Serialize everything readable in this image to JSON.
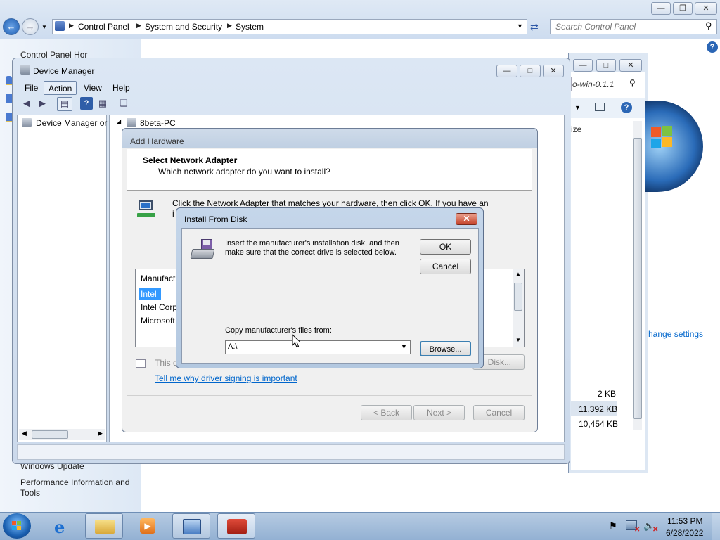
{
  "control_panel": {
    "breadcrumbs": [
      "Control Panel",
      "System and Security",
      "System"
    ],
    "search_placeholder": "Search Control Panel",
    "left_links": {
      "home": "Control Panel Hor",
      "windows_update": "Windows Update",
      "performance": "Performance Information and",
      "performance_2": "Tools"
    }
  },
  "system_window": {
    "search_value": "o-win-0.1.1",
    "col_header": "ize",
    "change_settings": "hange settings",
    "sizes": [
      "2 KB",
      "11,392 KB",
      "10,454 KB"
    ]
  },
  "device_manager": {
    "title": "Device Manager",
    "menu": [
      "File",
      "Action",
      "View",
      "Help"
    ],
    "tree_root": "Device Manager or",
    "computer_name": "8beta-PC"
  },
  "add_hardware": {
    "title": "Add Hardware",
    "heading": "Select Network Adapter",
    "subheading": "Which network adapter do you want to install?",
    "instruction": "Click the Network Adapter that matches your hardware, then click OK. If you have an",
    "instruction_cut": "i",
    "list_header": "Manufact",
    "manufacturers": [
      "Intel",
      "Intel Corp",
      "Microsoft"
    ],
    "signing_text": "This d",
    "signing_link": "Tell me why driver signing is important",
    "have_disk": "Disk...",
    "back": "< Back",
    "next": "Next >",
    "cancel": "Cancel"
  },
  "install_from_disk": {
    "title": "Install From Disk",
    "message_1": "Insert the manufacturer's installation disk, and then",
    "message_2": "make sure that the correct drive is selected below.",
    "ok": "OK",
    "cancel": "Cancel",
    "copy_label": "Copy manufacturer's files from:",
    "path": "A:\\",
    "browse": "Browse..."
  },
  "taskbar": {
    "time": "11:53 PM",
    "date": "6/28/2022"
  },
  "colors": {
    "selection": "#3399ff",
    "link": "#0066cc",
    "taskbar": "#a6bfdc"
  }
}
